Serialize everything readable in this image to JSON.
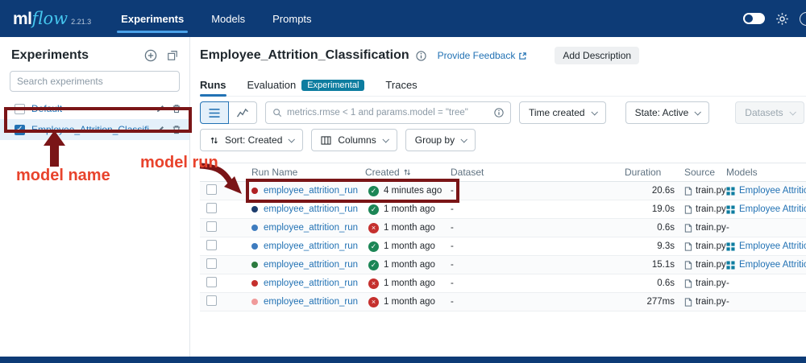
{
  "navbar": {
    "logo": {
      "ml": "ml",
      "flow": "flow",
      "version": "2.21.3"
    },
    "tabs": [
      {
        "label": "Experiments",
        "active": true
      },
      {
        "label": "Models",
        "active": false
      },
      {
        "label": "Prompts",
        "active": false
      }
    ]
  },
  "sidebar": {
    "title": "Experiments",
    "search_placeholder": "Search experiments",
    "items": [
      {
        "label": "Default",
        "selected": false
      },
      {
        "label": "Employee_Attrition_Classification",
        "selected": true
      }
    ]
  },
  "main": {
    "title": "Employee_Attrition_Classification",
    "feedback_link": "Provide Feedback",
    "add_description_label": "Add Description",
    "tabs": [
      {
        "label": "Runs",
        "active": true
      },
      {
        "label": "Evaluation",
        "active": false,
        "badge": "Experimental"
      },
      {
        "label": "Traces",
        "active": false
      }
    ],
    "toolbar": {
      "search_placeholder": "metrics.rmse < 1 and params.model = \"tree\"",
      "time_created_label": "Time created",
      "state_label": "State: Active",
      "datasets_label": "Datasets",
      "sort_label": "Sort: Created",
      "columns_label": "Columns",
      "group_by_label": "Group by"
    },
    "table": {
      "headers": {
        "run_name": "Run Name",
        "created": "Created",
        "dataset": "Dataset",
        "duration": "Duration",
        "source": "Source",
        "models": "Models"
      },
      "rows": [
        {
          "dot_color": "#b02124",
          "run_name": "employee_attrition_run",
          "status": "finished",
          "created": "4 minutes ago",
          "dataset": "-",
          "duration": "20.6s",
          "source": "train.py",
          "model": "Employee Attrition Mod"
        },
        {
          "dot_color": "#1d3d6d",
          "run_name": "employee_attrition_run",
          "status": "finished",
          "created": "1 month ago",
          "dataset": "-",
          "duration": "19.0s",
          "source": "train.py",
          "model": "Employee Attrition Mod"
        },
        {
          "dot_color": "#3e7cbf",
          "run_name": "employee_attrition_run",
          "status": "failed",
          "created": "1 month ago",
          "dataset": "-",
          "duration": "0.6s",
          "source": "train.py",
          "model": null
        },
        {
          "dot_color": "#3e7cbf",
          "run_name": "employee_attrition_run",
          "status": "finished",
          "created": "1 month ago",
          "dataset": "-",
          "duration": "9.3s",
          "source": "train.py",
          "model": "Employee Attrition Mod"
        },
        {
          "dot_color": "#2c7a3f",
          "run_name": "employee_attrition_run",
          "status": "finished",
          "created": "1 month ago",
          "dataset": "-",
          "duration": "15.1s",
          "source": "train.py",
          "model": "Employee Attrition Mod"
        },
        {
          "dot_color": "#c5302e",
          "run_name": "employee_attrition_run",
          "status": "failed",
          "created": "1 month ago",
          "dataset": "-",
          "duration": "0.6s",
          "source": "train.py",
          "model": null
        },
        {
          "dot_color": "#f09a9a",
          "run_name": "employee_attrition_run",
          "status": "failed",
          "created": "1 month ago",
          "dataset": "-",
          "duration": "277ms",
          "source": "train.py",
          "model": null
        }
      ]
    }
  },
  "annotations": {
    "model_name_label": "model name",
    "model_run_label": "model run"
  },
  "colors": {
    "navbar_bg": "#0d3b76",
    "accent_blue": "#2272b4",
    "badge_teal": "#0e7da0",
    "annotation_red": "#e8432c",
    "annotation_maroon": "#7a1517",
    "status_green": "#1c8656",
    "status_red": "#c5302e"
  }
}
